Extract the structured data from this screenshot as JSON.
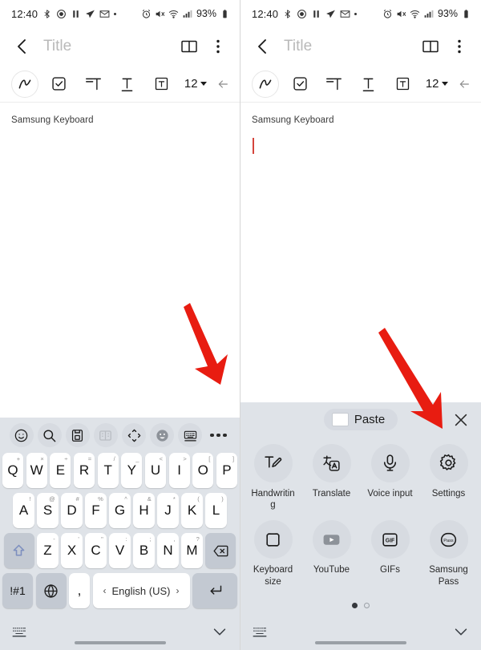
{
  "status_bar": {
    "time": "12:40",
    "left_icons": [
      "bluetooth-share-icon",
      "record-icon",
      "pause-icon",
      "send-icon",
      "mail-icon",
      "dot-icon"
    ],
    "right_icons": [
      "alarm-icon",
      "mute-icon",
      "wifi-icon",
      "signal-icon"
    ],
    "battery_percent": "93%",
    "battery_icon": "battery-icon"
  },
  "title_bar": {
    "back_icon": "back-chevron-icon",
    "title_placeholder": "Title",
    "book_icon": "book-icon",
    "overflow_icon": "more-vertical-icon"
  },
  "format_toolbar": {
    "items": [
      {
        "name": "pen-icon",
        "label": ""
      },
      {
        "name": "checklist-icon",
        "label": ""
      },
      {
        "name": "paragraph-format-icon",
        "label": ""
      },
      {
        "name": "text-style-icon",
        "label": ""
      },
      {
        "name": "text-box-icon",
        "label": ""
      }
    ],
    "font_size": "12",
    "collapse_icon": "arrow-left-icon"
  },
  "note": {
    "body_text": "Samsung Keyboard",
    "caret_color": "#d4453c"
  },
  "keyboard": {
    "toolbar_icons": [
      "emoji-icon",
      "search-icon",
      "clipboard-icon",
      "split-keyboard-icon",
      "move-keyboard-icon",
      "sticker-icon",
      "keyboard-mode-icon",
      "more-horizontal-icon"
    ],
    "row1": [
      {
        "key": "Q",
        "alt": "+"
      },
      {
        "key": "W",
        "alt": "×"
      },
      {
        "key": "E",
        "alt": "÷"
      },
      {
        "key": "R",
        "alt": "="
      },
      {
        "key": "T",
        "alt": "/"
      },
      {
        "key": "Y",
        "alt": "_"
      },
      {
        "key": "U",
        "alt": "<"
      },
      {
        "key": "I",
        "alt": ">"
      },
      {
        "key": "O",
        "alt": "["
      },
      {
        "key": "P",
        "alt": "]"
      }
    ],
    "row2": [
      {
        "key": "A",
        "alt": "!"
      },
      {
        "key": "S",
        "alt": "@"
      },
      {
        "key": "D",
        "alt": "#"
      },
      {
        "key": "F",
        "alt": "%"
      },
      {
        "key": "G",
        "alt": "^"
      },
      {
        "key": "H",
        "alt": "&"
      },
      {
        "key": "J",
        "alt": "*"
      },
      {
        "key": "K",
        "alt": "("
      },
      {
        "key": "L",
        "alt": ")"
      }
    ],
    "row3": [
      {
        "key": "Z",
        "alt": "-"
      },
      {
        "key": "X",
        "alt": "'"
      },
      {
        "key": "C",
        "alt": "\""
      },
      {
        "key": "V",
        "alt": ":"
      },
      {
        "key": "B",
        "alt": ";"
      },
      {
        "key": "N",
        "alt": ","
      },
      {
        "key": "M",
        "alt": "?"
      }
    ],
    "shift_icon": "shift-icon",
    "backspace_icon": "backspace-icon",
    "symbols_key": "!#1",
    "globe_icon": "globe-icon",
    "comma_key": ",",
    "space_label": "English (US)",
    "space_prev": "‹",
    "space_next": "›",
    "enter_icon": "enter-icon",
    "bottom_keyboard_icon": "keyboard-icon",
    "bottom_collapse_icon": "chevron-down-icon"
  },
  "expanded_menu": {
    "paste_label": "Paste",
    "paste_thumb": "clipboard-thumbnail",
    "close_icon": "close-icon",
    "items": [
      {
        "icon": "handwriting-icon",
        "label": "Handwriting"
      },
      {
        "icon": "translate-icon",
        "label": "Translate"
      },
      {
        "icon": "microphone-icon",
        "label": "Voice input"
      },
      {
        "icon": "gear-icon",
        "label": "Settings"
      },
      {
        "icon": "keyboard-size-icon",
        "label": "Keyboard size"
      },
      {
        "icon": "youtube-icon",
        "label": "YouTube"
      },
      {
        "icon": "gif-icon",
        "label": "GIFs"
      },
      {
        "icon": "samsung-pass-icon",
        "label": "Samsung Pass"
      }
    ],
    "page_dots": {
      "count": 2,
      "active": 0
    }
  },
  "annotations": {
    "arrow_color": "#e81c11",
    "arrow_left_target": "more-horizontal-icon",
    "arrow_right_target": "gear-icon"
  }
}
